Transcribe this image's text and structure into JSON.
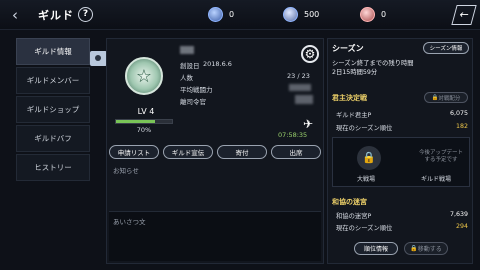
{
  "header": {
    "title": "ギルド",
    "currencies": [
      {
        "icon": "diamond-icon",
        "value": "0"
      },
      {
        "icon": "coin-icon",
        "value": "500"
      },
      {
        "icon": "drop-icon",
        "value": "0"
      }
    ]
  },
  "sidebar": {
    "items": [
      {
        "label": "ギルド情報",
        "active": true
      },
      {
        "label": "ギルドメンバー",
        "active": false
      },
      {
        "label": "ギルドショップ",
        "active": false
      },
      {
        "label": "ギルドバフ",
        "active": false
      },
      {
        "label": "ヒストリー",
        "active": false
      }
    ]
  },
  "guild": {
    "founded_label": "創設日",
    "founded_value": "2018.6.6",
    "members_label": "人数",
    "members_value": "23 / 23",
    "avg_power_label": "平均戦闘力",
    "motto_label": "離司令官",
    "level": "LV 4",
    "exp_percent_label": "70%",
    "exp_percent": 70,
    "timer": "07:58:35",
    "buttons": [
      "申請リスト",
      "ギルド宣伝",
      "寄付",
      "出席"
    ],
    "notice_label": "お知らせ",
    "greeting_label": "あいさつ文"
  },
  "season": {
    "title": "シーズン",
    "info_button": "シーズン情報",
    "remaining_label": "シーズン終了までの残り時間",
    "remaining_value": "2日15時間59分",
    "king_section": {
      "title": "君主決定戦",
      "match_button": "対戦配分",
      "point_label": "ギルド君主P",
      "point_value": "6,075",
      "rank_label": "現在のシーズン順位",
      "rank_value": "182"
    },
    "battles": {
      "left_label": "大戦場",
      "right_label": "ギルド戦場",
      "soon_text": "今後アップデートする予定です"
    },
    "maze_section": {
      "title": "和協の迷宮",
      "point_label": "和協の迷宮P",
      "point_value": "7,639",
      "rank_label": "現在のシーズン順位",
      "rank_value": "294"
    },
    "rank_button": "順位情報",
    "move_button": "移動する"
  }
}
